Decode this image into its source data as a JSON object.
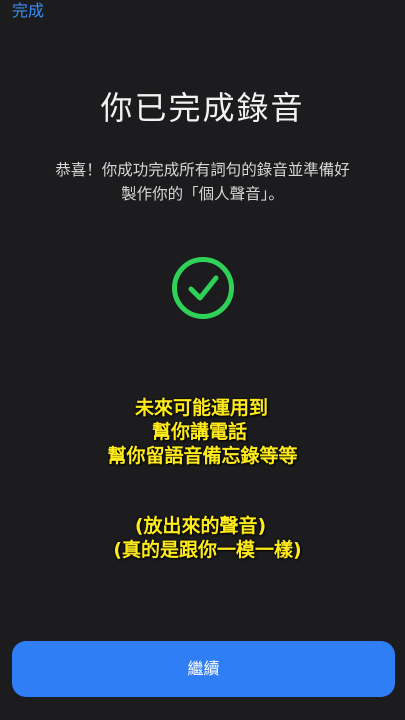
{
  "header": {
    "done_label": "完成"
  },
  "main": {
    "title": "你已完成錄音",
    "description_lines": [
      "恭喜！你成功完成所有詞句的錄音並準備好",
      "製作你的「個人聲音」。"
    ],
    "success_icon": "checkmark-circle-icon"
  },
  "overlay_caption": {
    "lines_group_1": [
      "未來可能運用到",
      "幫你講電話",
      "幫你留語音備忘錄等等"
    ],
    "lines_group_2": [
      "(放出來的聲音)",
      "(真的是跟你一模一樣)"
    ]
  },
  "footer": {
    "continue_label": "繼續"
  },
  "colors": {
    "background": "#1c1c1e",
    "accent": "#2f7ef5",
    "link": "#3a8df5",
    "success": "#30d158",
    "caption": "#ffeb1a"
  }
}
